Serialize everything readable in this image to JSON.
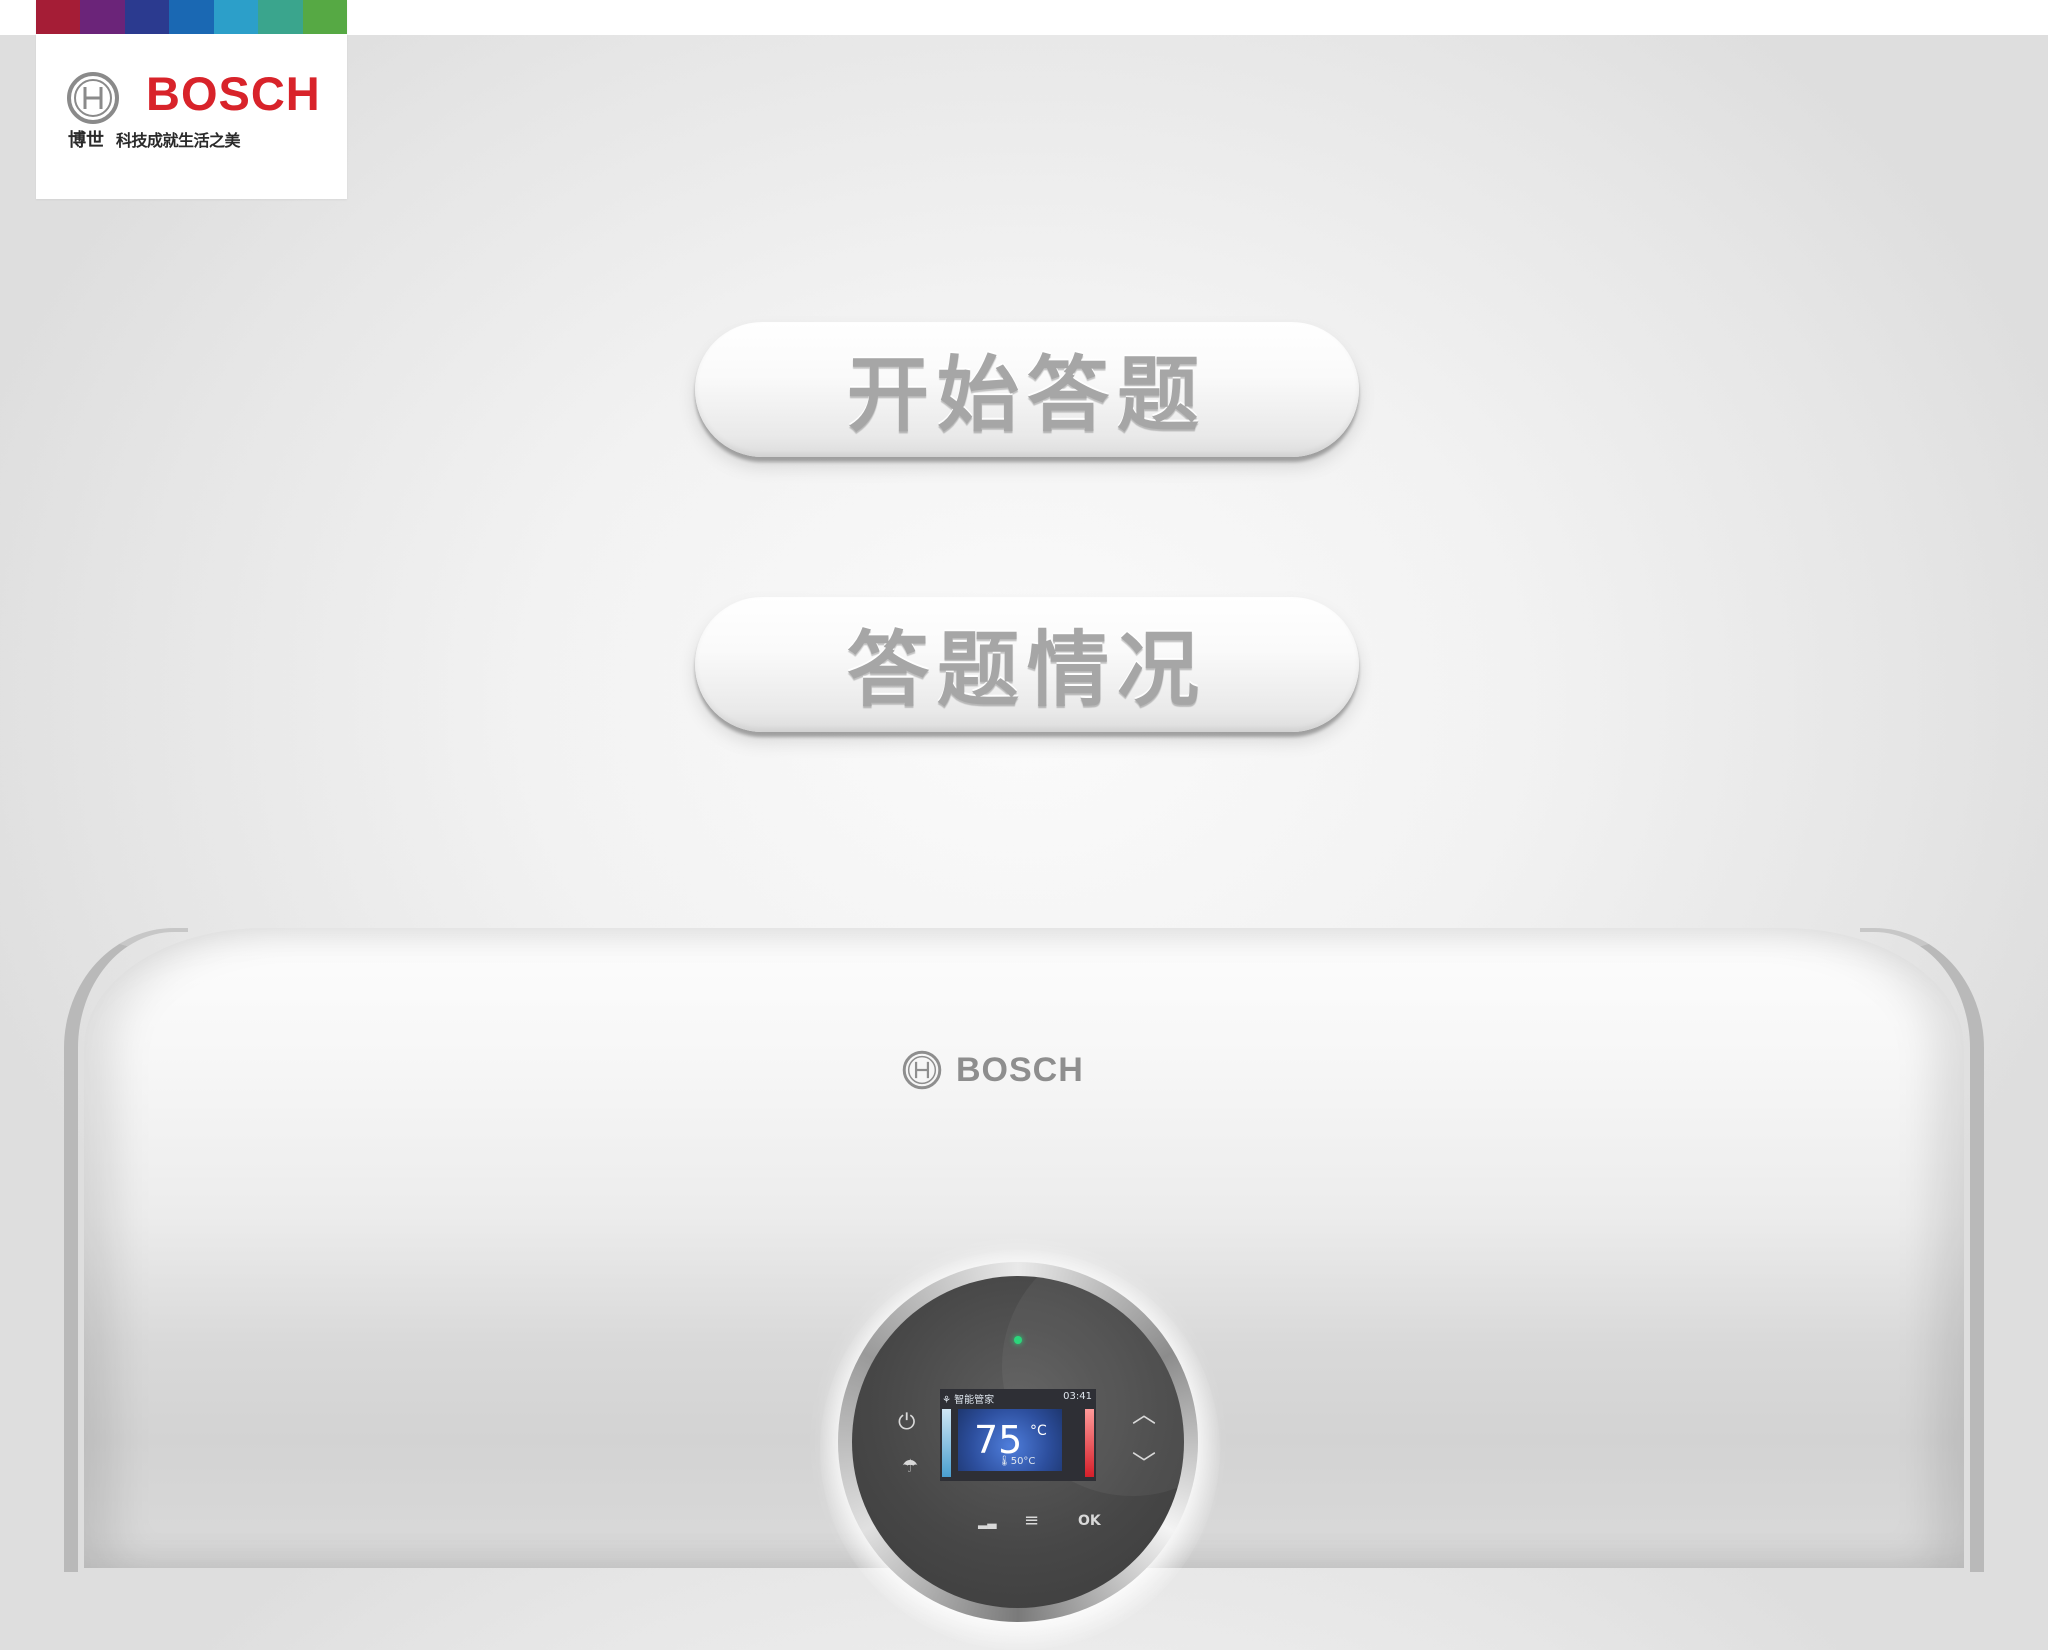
{
  "logo": {
    "brand": "BOSCH",
    "cn_name": "博世",
    "slogan": "科技成就生活之美",
    "bar_colors": [
      "#a51d36",
      "#6b2479",
      "#2b3a8f",
      "#1a68b3",
      "#2c9fc9",
      "#3aa58d",
      "#56a944"
    ]
  },
  "buttons": {
    "start_quiz": "开始答题",
    "quiz_status": "答题情况"
  },
  "heater": {
    "brand": "BOSCH",
    "screen": {
      "mode": "智能管家",
      "time": "03:41",
      "temperature": "75",
      "unit": "°C",
      "target": "50°C",
      "ok_label": "OK"
    }
  },
  "colors": {
    "brand_red": "#d8232a",
    "button_text": "#a6a6a6",
    "led_green": "#2bd67b"
  }
}
